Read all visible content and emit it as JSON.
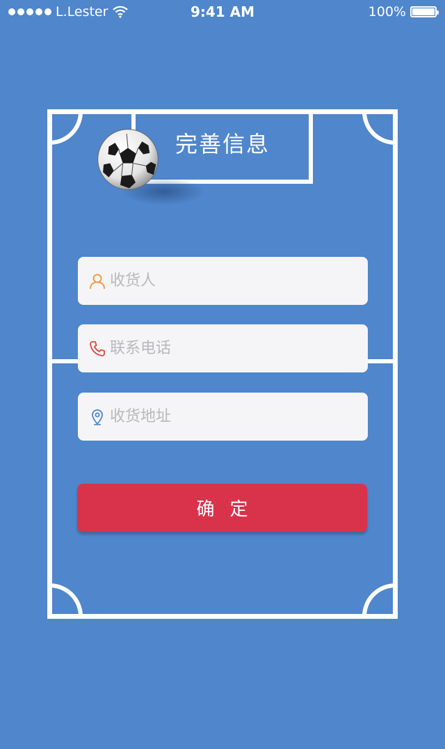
{
  "status_bar": {
    "carrier": "L.Lester",
    "time": "9:41 AM",
    "battery": "100%"
  },
  "header": {
    "title": "完善信息"
  },
  "form": {
    "receiver": {
      "placeholder": "收货人",
      "icon": "person-icon",
      "icon_color": "#f0a04b"
    },
    "phone": {
      "placeholder": "联系电话",
      "icon": "phone-icon",
      "icon_color": "#e0463c"
    },
    "address": {
      "placeholder": "收货地址",
      "icon": "location-pin-icon",
      "icon_color": "#4f86cc"
    }
  },
  "actions": {
    "confirm_label": "确定"
  },
  "colors": {
    "background": "#4f86cc",
    "button": "#d8334b",
    "input_bg": "#f5f5f7"
  }
}
